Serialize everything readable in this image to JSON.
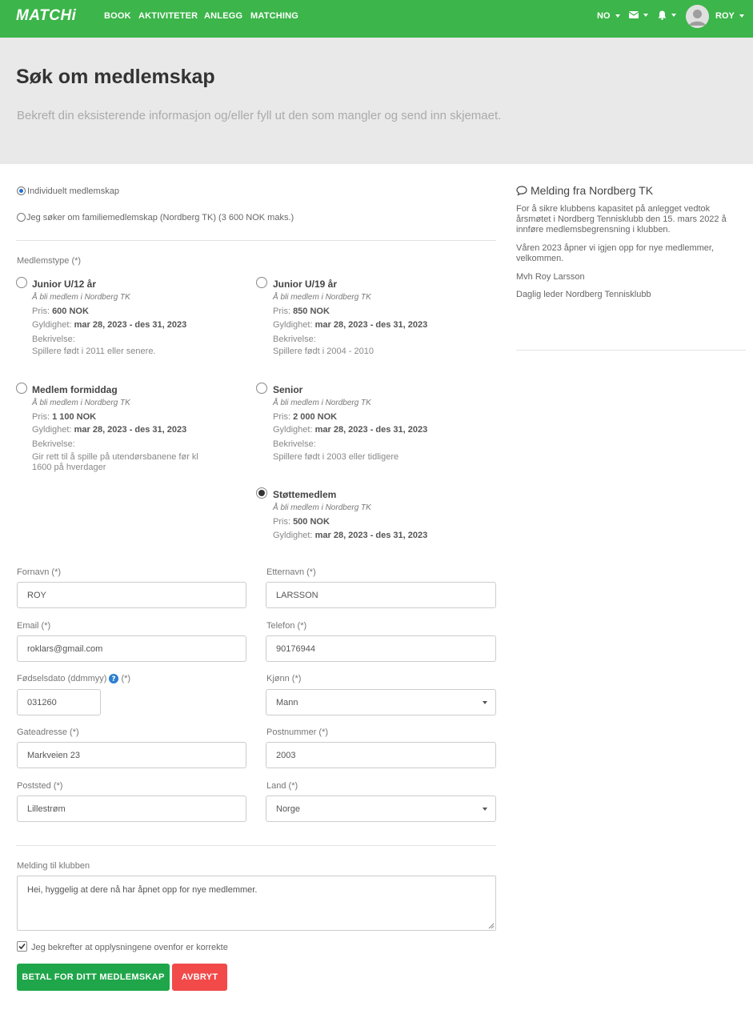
{
  "nav": {
    "brand": "MATCHi",
    "links": [
      "BOOK",
      "AKTIVITETER",
      "ANLEGG",
      "MATCHING"
    ],
    "lang": "NO",
    "user": "ROY"
  },
  "hero": {
    "title": "Søk om medlemskap",
    "subtitle": "Bekreft din eksisterende informasjon og/eller fyll ut den som mangler og send inn skjemaet."
  },
  "membership_kind": {
    "individual": "Individuelt medlemskap",
    "family": "Jeg søker om familiemedlemskap (Nordberg TK) (3 600 NOK maks.)",
    "selected": "individual"
  },
  "types_label": "Medlemstype (*)",
  "labels": {
    "price": "Pris:",
    "validity": "Gyldighet:",
    "description": "Bekrivelse:"
  },
  "types": [
    {
      "name": "Junior U/12 år",
      "sub": "Å bli medlem i Nordberg TK",
      "price": "600 NOK",
      "validity": "mar 28, 2023 - des 31, 2023",
      "desc1": "Spillere født i 2011 eller senere.",
      "desc2": ""
    },
    {
      "name": "Junior U/19 år",
      "sub": "Å bli medlem i Nordberg TK",
      "price": "850 NOK",
      "validity": "mar 28, 2023 - des 31, 2023",
      "desc1": "Spillere født i 2004 - 2010",
      "desc2": ""
    },
    {
      "name": "Medlem formiddag",
      "sub": "Å bli medlem i Nordberg TK",
      "price": "1 100 NOK",
      "validity": "mar 28, 2023 - des 31, 2023",
      "desc1": "Gir rett til å spille på utendørsbanene før kl",
      "desc2": "1600 på hverdager"
    },
    {
      "name": "Senior",
      "sub": "Å bli medlem i Nordberg TK",
      "price": "2 000 NOK",
      "validity": "mar 28, 2023 - des 31, 2023",
      "desc1": "Spillere født i 2003 eller tidligere",
      "desc2": ""
    },
    {
      "name": "Støttemedlem",
      "sub": "Å bli medlem i Nordberg TK",
      "price": "500 NOK",
      "validity": "mar 28, 2023 - des 31, 2023",
      "desc1": "",
      "desc2": ""
    }
  ],
  "selected_type": "Støttemedlem",
  "fields": {
    "firstname": {
      "label": "Fornavn (*)",
      "value": "ROY"
    },
    "lastname": {
      "label": "Etternavn (*)",
      "value": "LARSSON"
    },
    "email": {
      "label": "Email (*)",
      "value": "roklars@gmail.com"
    },
    "phone": {
      "label": "Telefon (*)",
      "value": "90176944"
    },
    "birthdate": {
      "label": "Fødselsdato (ddmmyy)",
      "required": "(*)",
      "value": "031260"
    },
    "gender": {
      "label": "Kjønn (*)",
      "value": "Mann"
    },
    "address": {
      "label": "Gateadresse (*)",
      "value": "Markveien 23"
    },
    "zip": {
      "label": "Postnummer (*)",
      "value": "2003"
    },
    "city": {
      "label": "Poststed (*)",
      "value": "Lillestrøm"
    },
    "country": {
      "label": "Land (*)",
      "value": "Norge"
    },
    "message": {
      "label": "Melding til klubben",
      "value": "Hei, hyggelig at dere nå har åpnet opp for nye medlemmer."
    }
  },
  "confirm": {
    "label": "Jeg bekrefter at opplysningene ovenfor er korrekte",
    "checked": true
  },
  "buttons": {
    "pay": "BETAL FOR DITT MEDLEMSKAP",
    "cancel": "AVBRYT"
  },
  "sidebar": {
    "title": "Melding fra Nordberg TK",
    "p1a": "For å sikre klubbens kapasitet på anlegget vedtok",
    "p1b": "årsmøtet i Nordberg Tennisklubb den 15. mars 2022 å",
    "p1c": "innføre medlemsbegrensning i klubben.",
    "p2a": "Våren 2023 åpner vi igjen opp for nye medlemmer,",
    "p2b": "velkommen.",
    "p3": "Mvh Roy Larsson",
    "p4": "Daglig leder Nordberg Tennisklubb"
  },
  "colors": {
    "nav": "#3cb54a",
    "pay": "#20a64a",
    "cancel": "#f24949",
    "hero": "#e9e9e9"
  }
}
